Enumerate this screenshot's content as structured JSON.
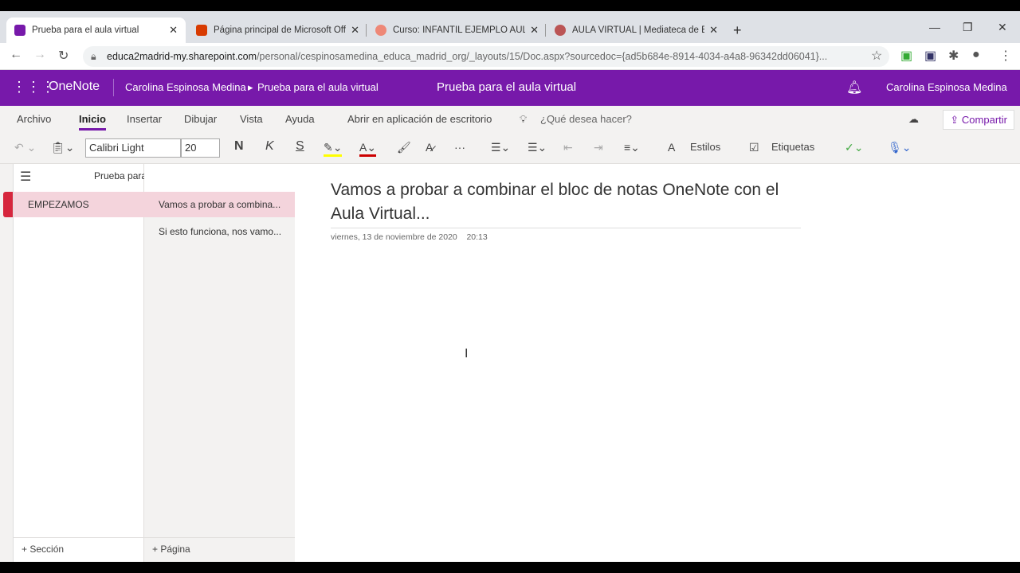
{
  "browser": {
    "tabs": [
      {
        "title": "Prueba para el aula virtual",
        "color": "#7719aa"
      },
      {
        "title": "Página principal de Microsoft Office",
        "color": "#d83b01"
      },
      {
        "title": "Curso: INFANTIL EJEMPLO AULA",
        "color": "#e87"
      },
      {
        "title": "AULA VIRTUAL | Mediateca de Educamadrid",
        "color": "#b55"
      }
    ],
    "new_tab": "+",
    "url_host": "educa2madrid-my.sharepoint.com",
    "url_path": "/personal/cespinosamedina_educa_madrid_org/_layouts/15/Doc.aspx?sourcedoc={ad5b684e-8914-4034-a4a8-96342dd06041}..."
  },
  "header": {
    "app": "OneNote",
    "breadcrumb_user": "Carolina Espinosa Medina",
    "breadcrumb_sep": "▸",
    "breadcrumb_notebook": "Prueba para el aula virtual",
    "title": "Prueba para el aula virtual",
    "user": "Carolina Espinosa Medina"
  },
  "ribbon": {
    "tabs": [
      "Archivo",
      "Inicio",
      "Insertar",
      "Dibujar",
      "Vista",
      "Ayuda"
    ],
    "open_desktop": "Abrir en aplicación de escritorio",
    "tell_me": "¿Qué desea hacer?",
    "share": "Compartir",
    "font": "Calibri Light",
    "size": "20",
    "bold": "N",
    "italic": "K",
    "underline": "S",
    "styles": "Estilos",
    "tags": "Etiquetas",
    "more": "···"
  },
  "nav": {
    "notebook": "Prueba para el aula virtual",
    "sections": [
      "EMPEZAMOS"
    ],
    "pages": [
      "Vamos a probar a combina...",
      "Si esto funciona, nos vamo..."
    ],
    "add_section": "Sección",
    "add_page": "Página"
  },
  "page": {
    "title": "Vamos a probar a combinar el bloc de notas OneNote con el Aula Virtual...",
    "date": "viernes, 13 de noviembre de 2020",
    "time": "20:13"
  }
}
